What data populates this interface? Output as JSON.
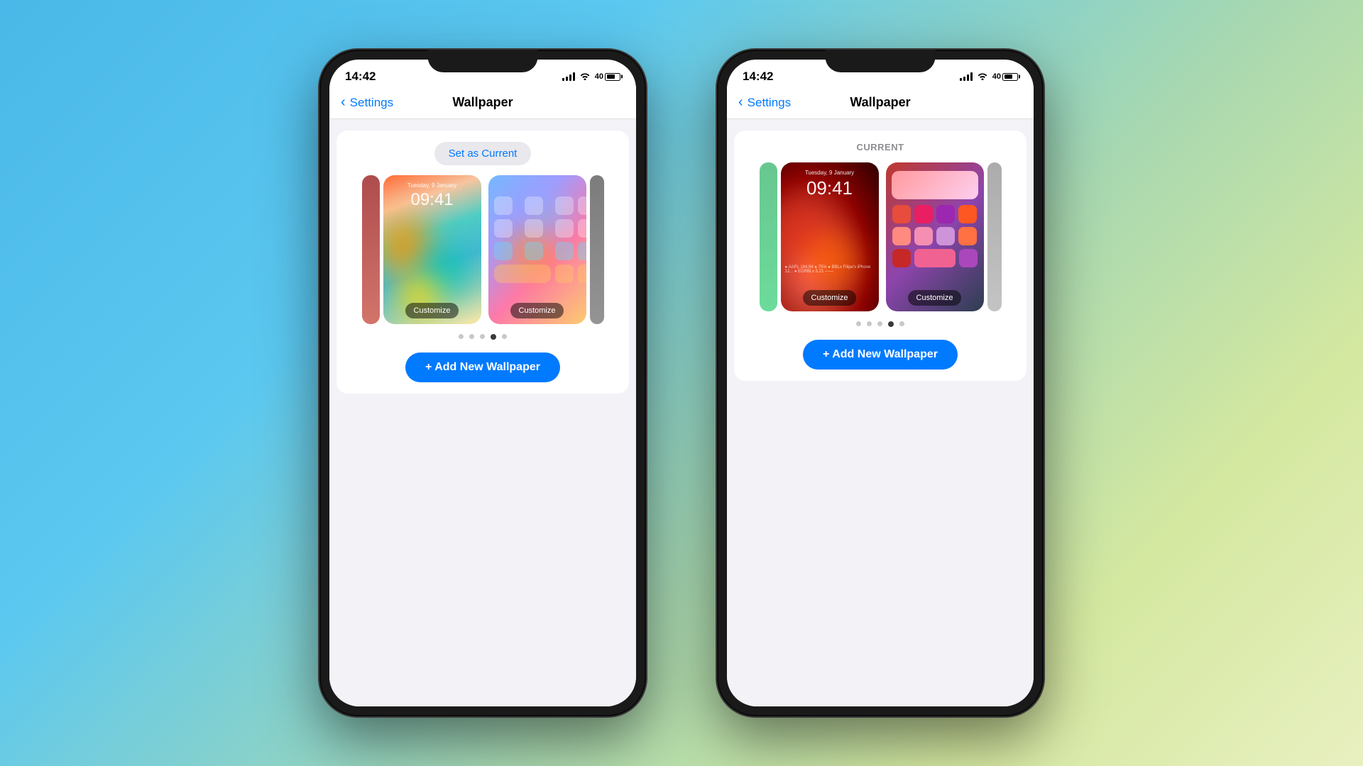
{
  "background": {
    "gradient": "linear-gradient(135deg, #4ab8e8 0%, #5bc8f0 30%, #a8d8b0 60%, #d4e8a0 80%, #e8f0c0 100%)"
  },
  "phone1": {
    "status": {
      "time": "14:42",
      "signal": "●●●●",
      "wifi": "wifi",
      "battery": "40"
    },
    "nav": {
      "back_label": "Settings",
      "title": "Wallpaper"
    },
    "content": {
      "set_current_label": "Set as Current",
      "add_wallpaper_label": "+ Add New Wallpaper",
      "customize_label": "Customize",
      "dots": [
        1,
        2,
        3,
        4,
        5
      ],
      "active_dot": 4
    }
  },
  "phone2": {
    "status": {
      "time": "14:42",
      "signal": "●●●●",
      "wifi": "wifi",
      "battery": "40"
    },
    "nav": {
      "back_label": "Settings",
      "title": "Wallpaper"
    },
    "content": {
      "current_label": "CURRENT",
      "add_wallpaper_label": "+ Add New Wallpaper",
      "customize_label": "Customize",
      "dots": [
        1,
        2,
        3,
        4,
        5
      ],
      "active_dot": 4
    }
  }
}
